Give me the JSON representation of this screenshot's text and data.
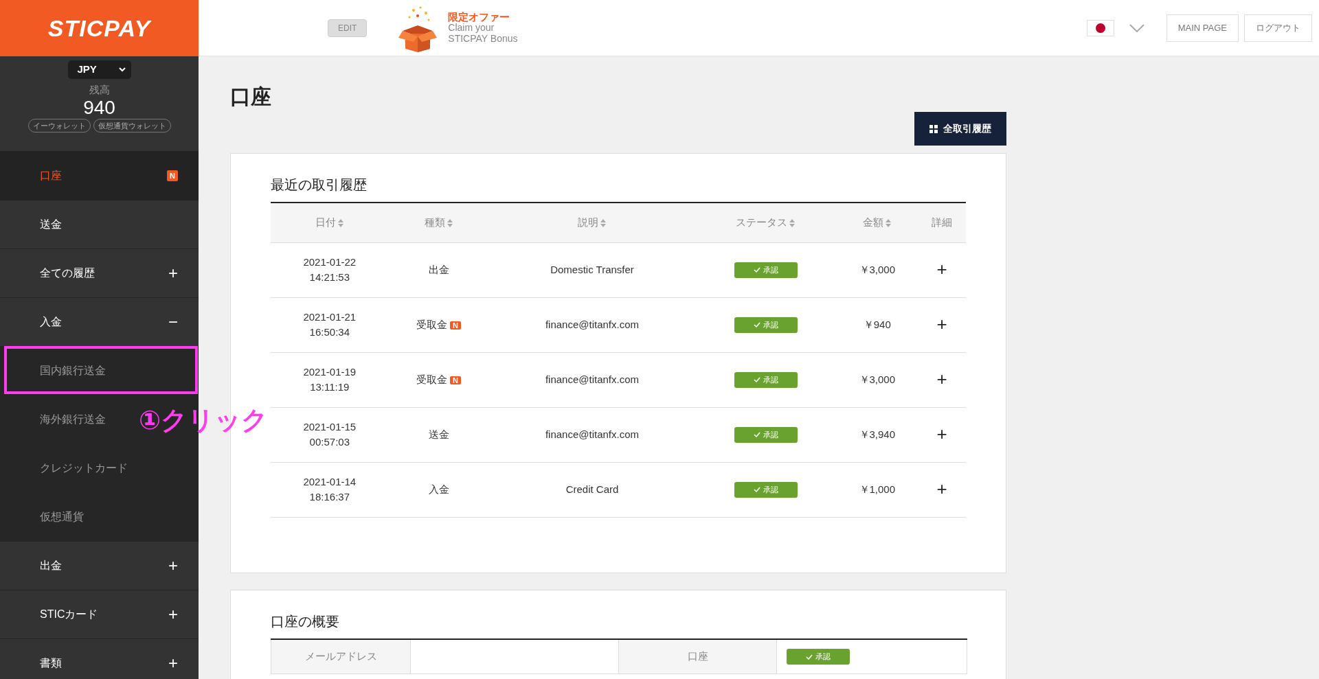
{
  "brand": "STICPAY",
  "balance": {
    "currency": "JPY",
    "label": "残高",
    "amount": "940",
    "wallets": [
      "イーウォレット",
      "仮想通貨ウォレット"
    ]
  },
  "menu": [
    {
      "label": "口座",
      "selected": true,
      "badge": "N"
    },
    {
      "label": "送金",
      "selected": false
    },
    {
      "label": "全ての履歴",
      "selected": false,
      "toggle": "+"
    },
    {
      "label": "入金",
      "selected": false,
      "toggle": "−",
      "children": [
        {
          "label": "国内銀行送金",
          "highlighted": true
        },
        {
          "label": "海外銀行送金",
          "highlighted": false
        },
        {
          "label": "クレジットカード",
          "highlighted": false
        },
        {
          "label": "仮想通貨",
          "highlighted": false
        }
      ]
    },
    {
      "label": "出金",
      "selected": false,
      "toggle": "+"
    },
    {
      "label": "STICカード",
      "selected": false,
      "toggle": "+"
    },
    {
      "label": "書類",
      "selected": false,
      "toggle": "+"
    }
  ],
  "annotation": "①クリック",
  "header": {
    "edit": "EDIT",
    "promo": {
      "title": "限定オファー",
      "lines": [
        "Claim your",
        "STICPAY Bonus"
      ]
    },
    "buttons": [
      "MAIN PAGE",
      "ログアウト"
    ]
  },
  "page_title": "口座",
  "history_button": "全取引履歴",
  "recent": {
    "title": "最近の取引履歴",
    "columns": [
      {
        "label": "日付",
        "sortable": true
      },
      {
        "label": "種類",
        "sortable": true
      },
      {
        "label": "説明",
        "sortable": true
      },
      {
        "label": "ステータス",
        "sortable": true
      },
      {
        "label": "金額",
        "sortable": true
      },
      {
        "label": "詳細",
        "sortable": false
      }
    ],
    "rows": [
      {
        "date": "2021-01-22",
        "time": "14:21:53",
        "type": "出金",
        "description": "Domestic Transfer",
        "status": "承認",
        "amount": "￥3,000",
        "detail": "+"
      },
      {
        "date": "2021-01-21",
        "time": "16:50:34",
        "type": "受取金",
        "badge": "N",
        "description": "finance@titanfx.com",
        "status": "承認",
        "amount": "￥940",
        "detail": "+"
      },
      {
        "date": "2021-01-19",
        "time": "13:11:19",
        "type": "受取金",
        "badge": "N",
        "description": "finance@titanfx.com",
        "status": "承認",
        "amount": "￥3,000",
        "detail": "+"
      },
      {
        "date": "2021-01-15",
        "time": "00:57:03",
        "type": "送金",
        "description": "finance@titanfx.com",
        "status": "承認",
        "amount": "￥3,940",
        "detail": "+"
      },
      {
        "date": "2021-01-14",
        "time": "18:16:37",
        "type": "入金",
        "description": "Credit Card",
        "status": "承認",
        "amount": "￥1,000",
        "detail": "+"
      }
    ]
  },
  "summary": {
    "title": "口座の概要",
    "fields": [
      {
        "label": "メールアドレス"
      },
      {
        "label": "口座",
        "status": "承認"
      }
    ]
  }
}
